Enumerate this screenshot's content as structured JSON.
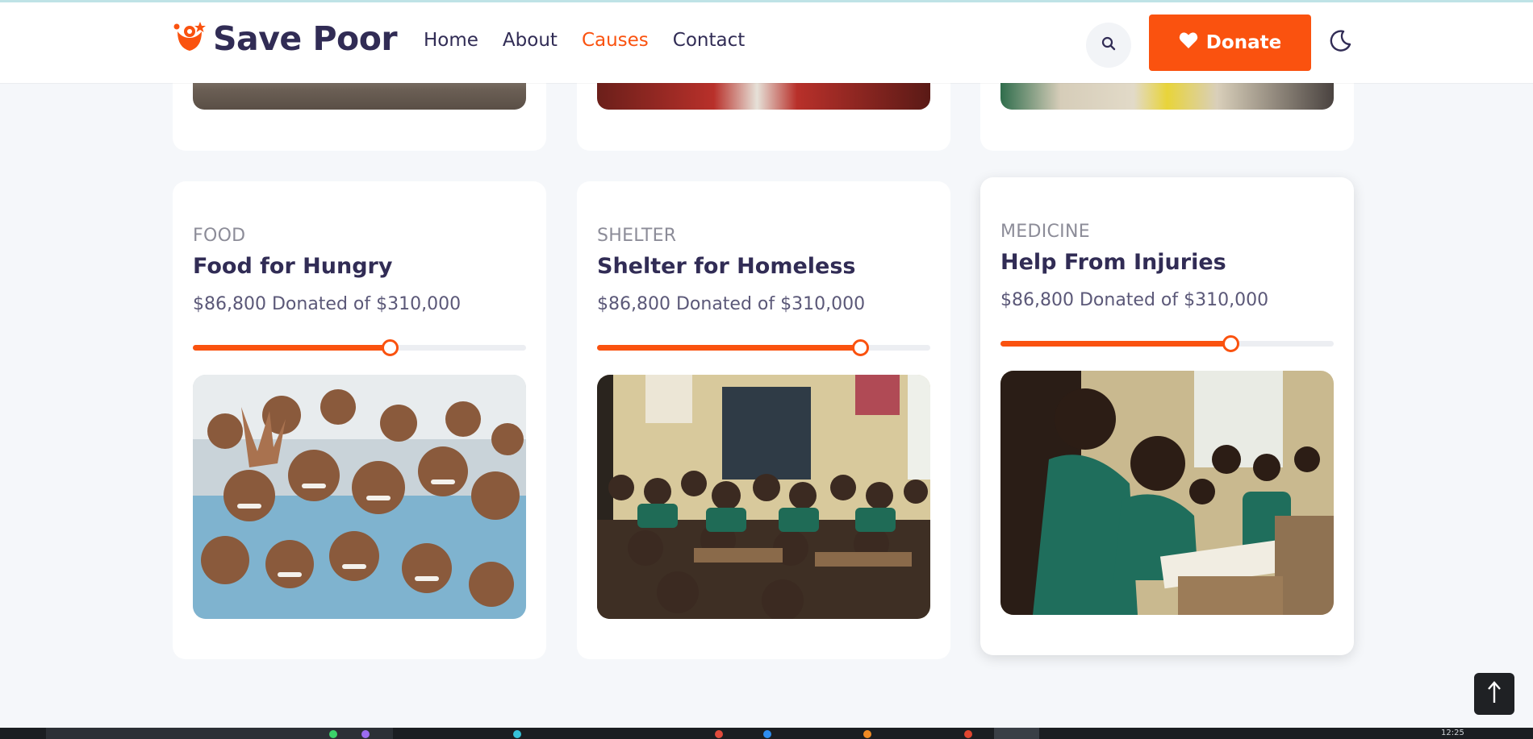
{
  "brand": {
    "name": "Save Poor"
  },
  "nav": {
    "items": [
      "Home",
      "About",
      "Causes",
      "Contact"
    ],
    "active": "Causes"
  },
  "actions": {
    "donate_label": "Donate"
  },
  "colors": {
    "accent": "#fa520f",
    "text": "#312c55",
    "muted": "#8c8c98",
    "background": "#f5f7fa"
  },
  "causes": [
    {
      "category": "FOOD",
      "title": "Food for Hungry",
      "amount": "$86,800 Donated of $310,000",
      "progress_percent": 59
    },
    {
      "category": "SHELTER",
      "title": "Shelter for Homeless",
      "amount": "$86,800 Donated of $310,000",
      "progress_percent": 79
    },
    {
      "category": "MEDICINE",
      "title": "Help From Injuries",
      "amount": "$86,800 Donated of $310,000",
      "progress_percent": 69
    }
  ],
  "taskbar": {
    "clock": "12:25"
  },
  "icons": [
    "logo-icon",
    "search-icon",
    "heart-icon",
    "moon-icon",
    "arrow-up-icon"
  ]
}
